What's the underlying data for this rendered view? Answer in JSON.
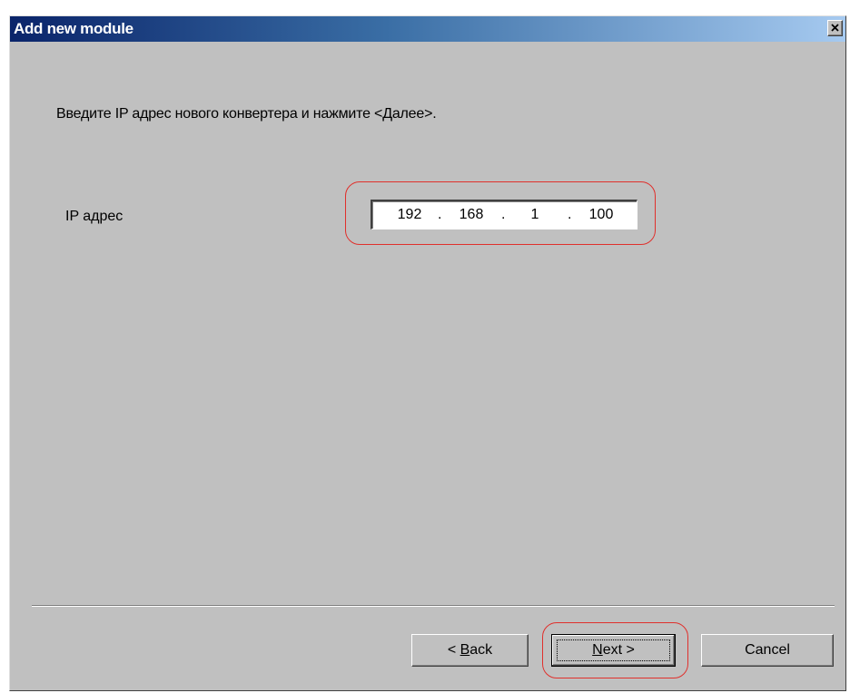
{
  "window": {
    "title": "Add new module"
  },
  "main": {
    "instruction": "Введите IP адрес нового конвертера и нажмите <Далее>.",
    "ip_label": "IP адрес",
    "ip_octets": [
      "192",
      "168",
      "1",
      "100"
    ],
    "ip_separator": "."
  },
  "buttons": {
    "back_prefix": "< ",
    "back_accel": "B",
    "back_rest": "ack",
    "next_accel": "N",
    "next_rest": "ext >",
    "cancel": "Cancel"
  },
  "icons": {
    "close": "close-icon"
  },
  "colors": {
    "titlebar_start": "#0a246a",
    "titlebar_end": "#a6caf0",
    "dialog_face": "#c0c0c0",
    "annotation": "#e0302c"
  }
}
